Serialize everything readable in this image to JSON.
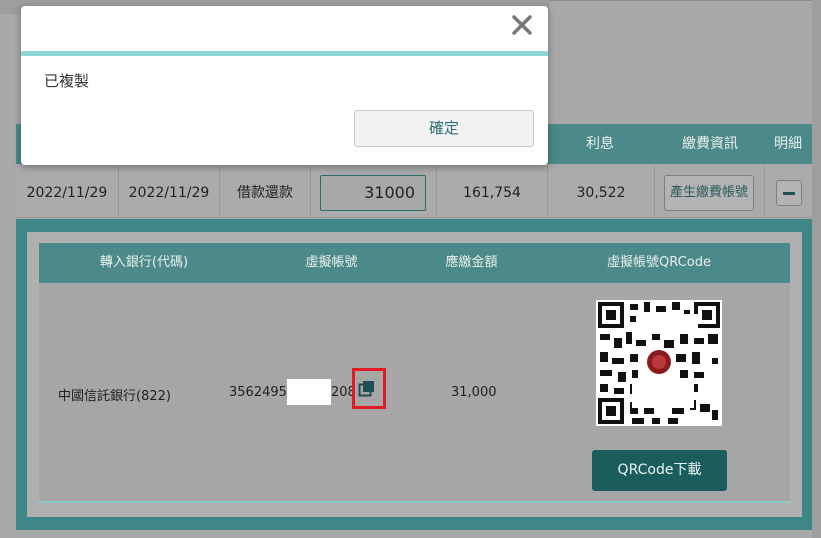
{
  "modal": {
    "message": "已複製",
    "ok_label": "確定",
    "close_icon": "close-icon"
  },
  "table": {
    "headers": {
      "interest": "利息",
      "payment_info": "繳費資訊",
      "details": "明細"
    },
    "row": {
      "date1": "2022/11/29",
      "date2": "2022/11/29",
      "type": "借款還款",
      "amount_input": "31000",
      "principal": "161,754",
      "interest": "30,522",
      "gen_button": "產生繳費帳號",
      "collapse_icon": "minus-icon"
    }
  },
  "detail": {
    "headers": {
      "bank": "轉入銀行(代碼)",
      "virtual_account": "虛擬帳號",
      "amount_due": "應繳金額",
      "qrcode": "虛擬帳號QRCode"
    },
    "bank": "中國信託銀行(822)",
    "account_prefix": "3562495",
    "account_suffix": "208",
    "amount_due": "31,000",
    "copy_icon": "copy-icon",
    "qr_button": "QRCode下載"
  },
  "colors": {
    "teal_header": "#4b8a88",
    "teal_button": "#1b5c5d",
    "highlight_red": "#e01b23",
    "modal_accent": "#8fd6d6"
  }
}
